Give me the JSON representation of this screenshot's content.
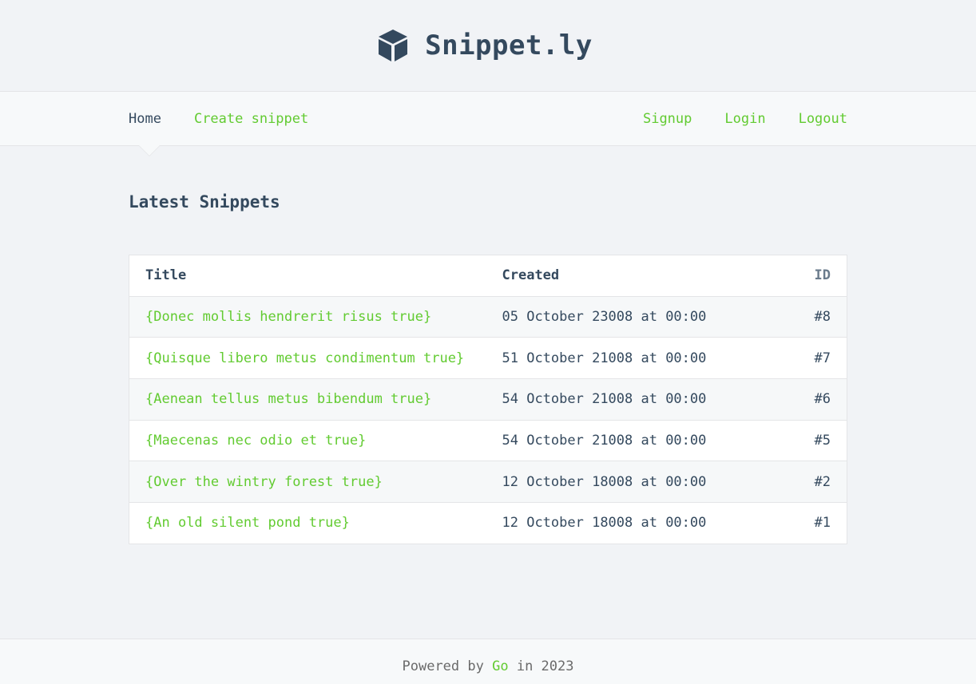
{
  "header": {
    "logo_icon": "cube-icon",
    "title": "Snippet.ly"
  },
  "nav": {
    "left": [
      {
        "label": "Home",
        "active": true
      },
      {
        "label": "Create snippet",
        "active": false
      }
    ],
    "right": [
      {
        "label": "Signup"
      },
      {
        "label": "Login"
      },
      {
        "label": "Logout"
      }
    ]
  },
  "main": {
    "title": "Latest Snippets",
    "table": {
      "columns": [
        "Title",
        "Created",
        "ID"
      ],
      "rows": [
        {
          "title": "{Donec mollis hendrerit risus true}",
          "created": "05 October 23008 at 00:00",
          "id": "#8"
        },
        {
          "title": "{Quisque libero metus condimentum true}",
          "created": "51 October 21008 at 00:00",
          "id": "#7"
        },
        {
          "title": "{Aenean tellus metus bibendum true}",
          "created": "54 October 21008 at 00:00",
          "id": "#6"
        },
        {
          "title": "{Maecenas nec odio et true}",
          "created": "54 October 21008 at 00:00",
          "id": "#5"
        },
        {
          "title": "{Over the wintry forest true}",
          "created": "12 October 18008 at 00:00",
          "id": "#2"
        },
        {
          "title": "{An old silent pond true}",
          "created": "12 October 18008 at 00:00",
          "id": "#1"
        }
      ]
    }
  },
  "footer": {
    "prefix": "Powered by",
    "link": "Go",
    "suffix": "in 2023"
  },
  "colors": {
    "accent": "#62cb31",
    "text": "#34495e",
    "background": "#f1f3f6"
  }
}
